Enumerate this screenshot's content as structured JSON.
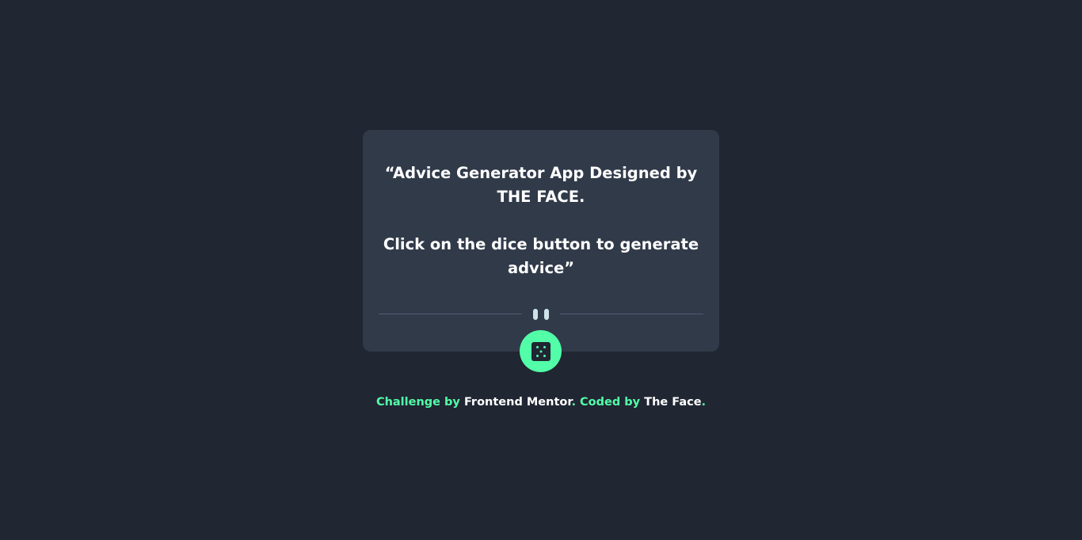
{
  "advice": {
    "line1": "“Advice Generator App Designed by THE FACE.",
    "line2": "Click on the dice button to generate advice”"
  },
  "divider": {
    "icon": "pause-icon"
  },
  "dice_button": {
    "icon": "dice-icon"
  },
  "attribution": {
    "challenge_prefix": "Challenge by",
    "challenge_link": "Frontend Mentor",
    "sep": ".",
    "coded_prefix": "Coded by",
    "coded_link": "The Face",
    "end": "."
  },
  "colors": {
    "background": "#202632",
    "card": "#313a49",
    "accent": "#52ffa8",
    "divider_line": "#4f5d74",
    "pause_icon": "#cee3e9",
    "text": "#ffffff"
  }
}
